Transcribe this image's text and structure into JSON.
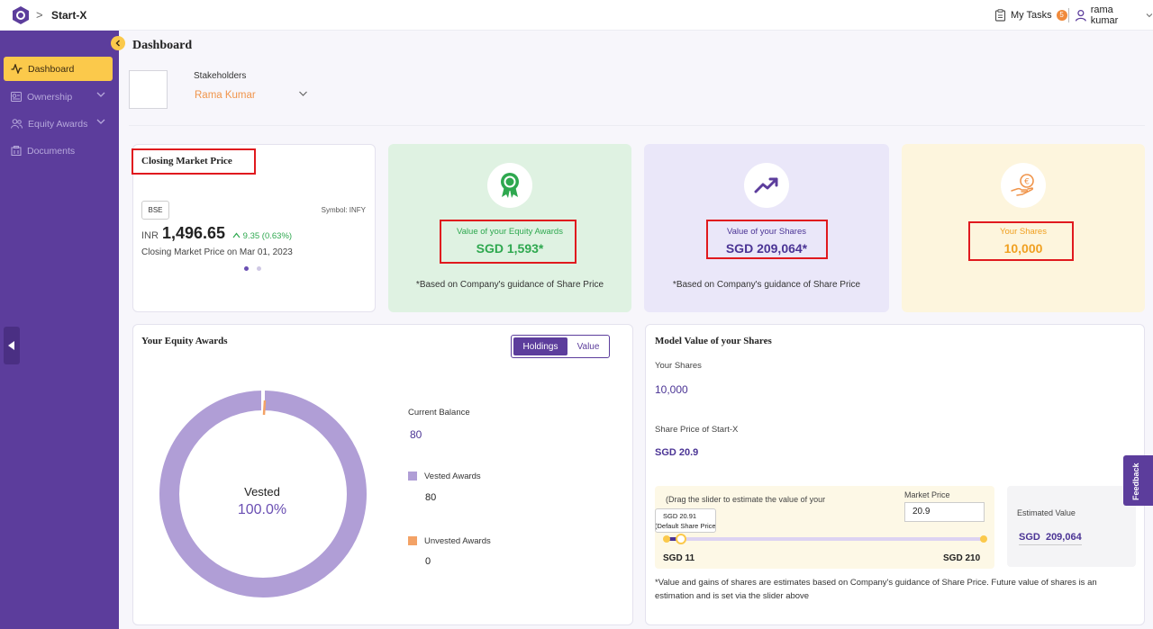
{
  "header": {
    "app_name": "Start-X",
    "breadcrumb_sep": ">",
    "tasks_label": "My Tasks",
    "tasks_count": "5",
    "user_name": "rama kumar"
  },
  "sidebar": {
    "items": [
      {
        "label": "Dashboard",
        "icon": "activity-icon",
        "active": true
      },
      {
        "label": "Ownership",
        "icon": "ownership-icon",
        "expandable": true
      },
      {
        "label": "Equity Awards",
        "icon": "users-icon",
        "expandable": true
      },
      {
        "label": "Documents",
        "icon": "documents-icon"
      }
    ]
  },
  "page": {
    "title": "Dashboard",
    "stakeholders_label": "Stakeholders",
    "stakeholder_selected": "Rama Kumar"
  },
  "closing_market": {
    "title": "Closing Market Price",
    "exchange": "BSE",
    "symbol": "Symbol: INFY",
    "currency": "INR",
    "price": "1,496.65",
    "change": "9.35 (0.63%)",
    "date_text": "Closing Market Price on Mar 01, 2023"
  },
  "equity_value_card": {
    "label": "Value of your Equity Awards",
    "value": "SGD 1,593*",
    "note": "*Based on Company's guidance of Share Price",
    "color": "#2ea84f"
  },
  "shares_value_card": {
    "label": "Value of your Shares",
    "value": "SGD 209,064*",
    "note": "*Based on Company's guidance of Share Price",
    "color": "#4b3495"
  },
  "your_shares_card": {
    "label": "Your Shares",
    "value": "10,000",
    "color": "#f0a020"
  },
  "equity_awards": {
    "title": "Your Equity Awards",
    "toggle": [
      "Holdings",
      "Value"
    ],
    "donut_label": "Vested",
    "donut_pct": "100.0%",
    "vested_fraction": 1.0,
    "current_balance_label": "Current Balance",
    "current_balance": "80",
    "vested_label": "Vested Awards",
    "vested": "80",
    "unvested_label": "Unvested Awards",
    "unvested": "0",
    "colors": {
      "vested": "#b09ed6",
      "unvested": "#f3a266"
    }
  },
  "model_value": {
    "title": "Model Value of your Shares",
    "your_shares_label": "Your Shares",
    "your_shares": "10,000",
    "share_price_label": "Share Price of Start-X",
    "share_price": "SGD 20.9",
    "slider_hint": "(Drag the slider to estimate the value of your",
    "tooltip_line1": "SGD 20.91",
    "tooltip_line2": "(Default Share Price)",
    "market_price_label": "Market Price",
    "market_price": "20.9",
    "min_label": "SGD 11",
    "max_label": "SGD 210",
    "estimated_label": "Estimated Value",
    "estimated_value": "SGD  209,064",
    "footnote": "*Value and gains of shares are estimates based on Company's guidance of Share Price. Future value of shares is an estimation and is set via the slider above"
  },
  "feedback_label": "Feedback"
}
